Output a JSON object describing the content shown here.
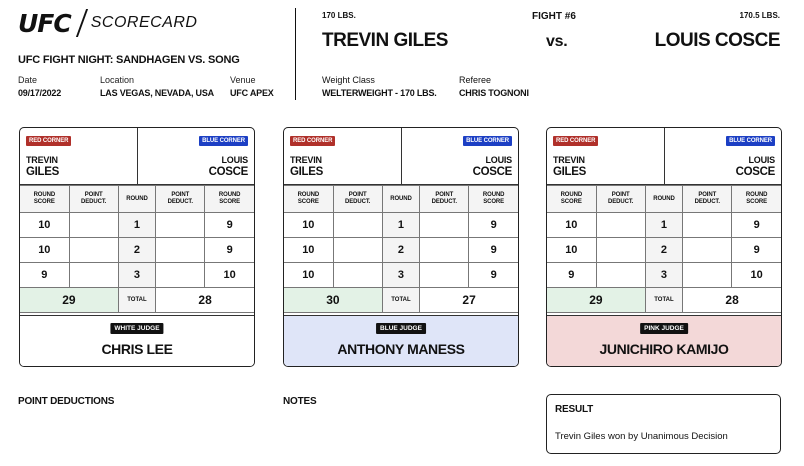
{
  "header": {
    "logo_ufc": "UFC",
    "logo_scorecard": "SCORECARD",
    "event_title": "UFC FIGHT NIGHT: SANDHAGEN VS. SONG",
    "date_label": "Date",
    "date": "09/17/2022",
    "location_label": "Location",
    "location": "LAS VEGAS, NEVADA, USA",
    "venue_label": "Venue",
    "venue": "UFC APEX"
  },
  "fight": {
    "red_weight": "170 LBS.",
    "red_name": "TREVIN GILES",
    "fight_number": "FIGHT #6",
    "vs": "vs.",
    "blue_weight": "170.5 LBS.",
    "blue_name": "LOUIS COSCE",
    "weight_class_label": "Weight Class",
    "weight_class": "WELTERWEIGHT - 170 LBS.",
    "referee_label": "Referee",
    "referee": "CHRIS TOGNONI"
  },
  "labels": {
    "red_corner": "RED CORNER",
    "blue_corner": "BLUE CORNER",
    "round_score": [
      "ROUND",
      "SCORE"
    ],
    "point_deduct": [
      "POINT",
      "DEDUCT."
    ],
    "round": "ROUND",
    "total": "TOTAL"
  },
  "fighters": {
    "red_first": "TREVIN",
    "red_last": "GILES",
    "blue_first": "LOUIS",
    "blue_last": "COSCE"
  },
  "colors": {
    "red_corner": "#b0302a",
    "blue_corner": "#1c3fc4",
    "red_total_bg": "#e3f2e6",
    "blue_judge_bg": "#dfe5f8",
    "pink_judge_bg": "#f3d8d8"
  },
  "cards": [
    {
      "judge_badge": "WHITE JUDGE",
      "judge_name": "CHRIS LEE",
      "judge_bg": "#ffffff",
      "rounds": [
        {
          "round": "1",
          "red": "10",
          "red_deduct": "",
          "blue_deduct": "",
          "blue": "9"
        },
        {
          "round": "2",
          "red": "10",
          "red_deduct": "",
          "blue_deduct": "",
          "blue": "9"
        },
        {
          "round": "3",
          "red": "9",
          "red_deduct": "",
          "blue_deduct": "",
          "blue": "10"
        }
      ],
      "red_total": "29",
      "blue_total": "28"
    },
    {
      "judge_badge": "BLUE JUDGE",
      "judge_name": "ANTHONY MANESS",
      "judge_bg": "#dfe5f8",
      "rounds": [
        {
          "round": "1",
          "red": "10",
          "red_deduct": "",
          "blue_deduct": "",
          "blue": "9"
        },
        {
          "round": "2",
          "red": "10",
          "red_deduct": "",
          "blue_deduct": "",
          "blue": "9"
        },
        {
          "round": "3",
          "red": "10",
          "red_deduct": "",
          "blue_deduct": "",
          "blue": "9"
        }
      ],
      "red_total": "30",
      "blue_total": "27"
    },
    {
      "judge_badge": "PINK JUDGE",
      "judge_name": "JUNICHIRO KAMIJO",
      "judge_bg": "#f3d8d8",
      "rounds": [
        {
          "round": "1",
          "red": "10",
          "red_deduct": "",
          "blue_deduct": "",
          "blue": "9"
        },
        {
          "round": "2",
          "red": "10",
          "red_deduct": "",
          "blue_deduct": "",
          "blue": "9"
        },
        {
          "round": "3",
          "red": "9",
          "red_deduct": "",
          "blue_deduct": "",
          "blue": "10"
        }
      ],
      "red_total": "29",
      "blue_total": "28"
    }
  ],
  "footer": {
    "point_deductions_title": "POINT DEDUCTIONS",
    "notes_title": "NOTES",
    "result_title": "RESULT",
    "result_text": "Trevin Giles won by Unanimous Decision"
  }
}
